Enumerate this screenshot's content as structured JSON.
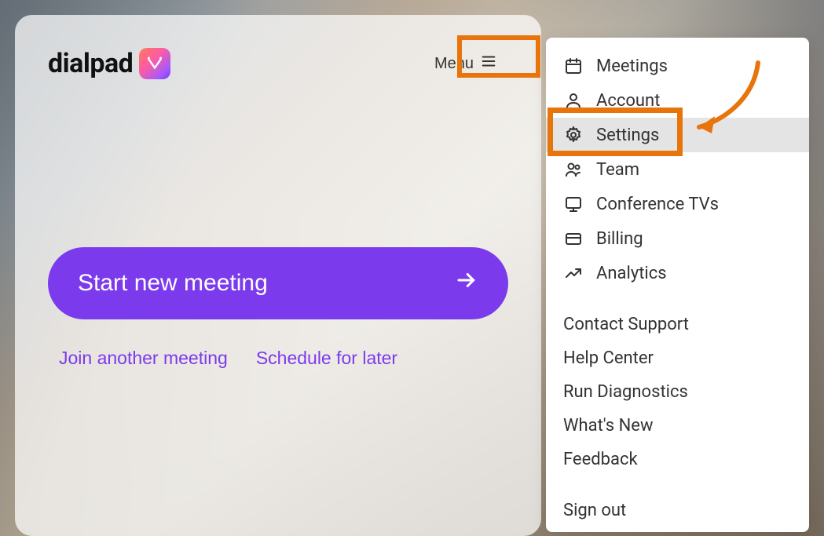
{
  "logo": {
    "text": "dialpad"
  },
  "header": {
    "menu_label": "Menu"
  },
  "actions": {
    "primary": "Start new meeting",
    "join": "Join another meeting",
    "schedule": "Schedule for later"
  },
  "menu": {
    "items": [
      {
        "label": "Meetings",
        "icon": "calendar"
      },
      {
        "label": "Account",
        "icon": "user"
      },
      {
        "label": "Settings",
        "icon": "gear",
        "selected": true
      },
      {
        "label": "Team",
        "icon": "users"
      },
      {
        "label": "Conference TVs",
        "icon": "monitor"
      },
      {
        "label": "Billing",
        "icon": "card"
      },
      {
        "label": "Analytics",
        "icon": "trend"
      }
    ],
    "support": [
      {
        "label": "Contact Support"
      },
      {
        "label": "Help Center"
      },
      {
        "label": "Run Diagnostics"
      },
      {
        "label": "What's New"
      },
      {
        "label": "Feedback"
      }
    ],
    "signout": "Sign out"
  },
  "colors": {
    "accent": "#7c3aed",
    "highlight": "#e8740c"
  }
}
